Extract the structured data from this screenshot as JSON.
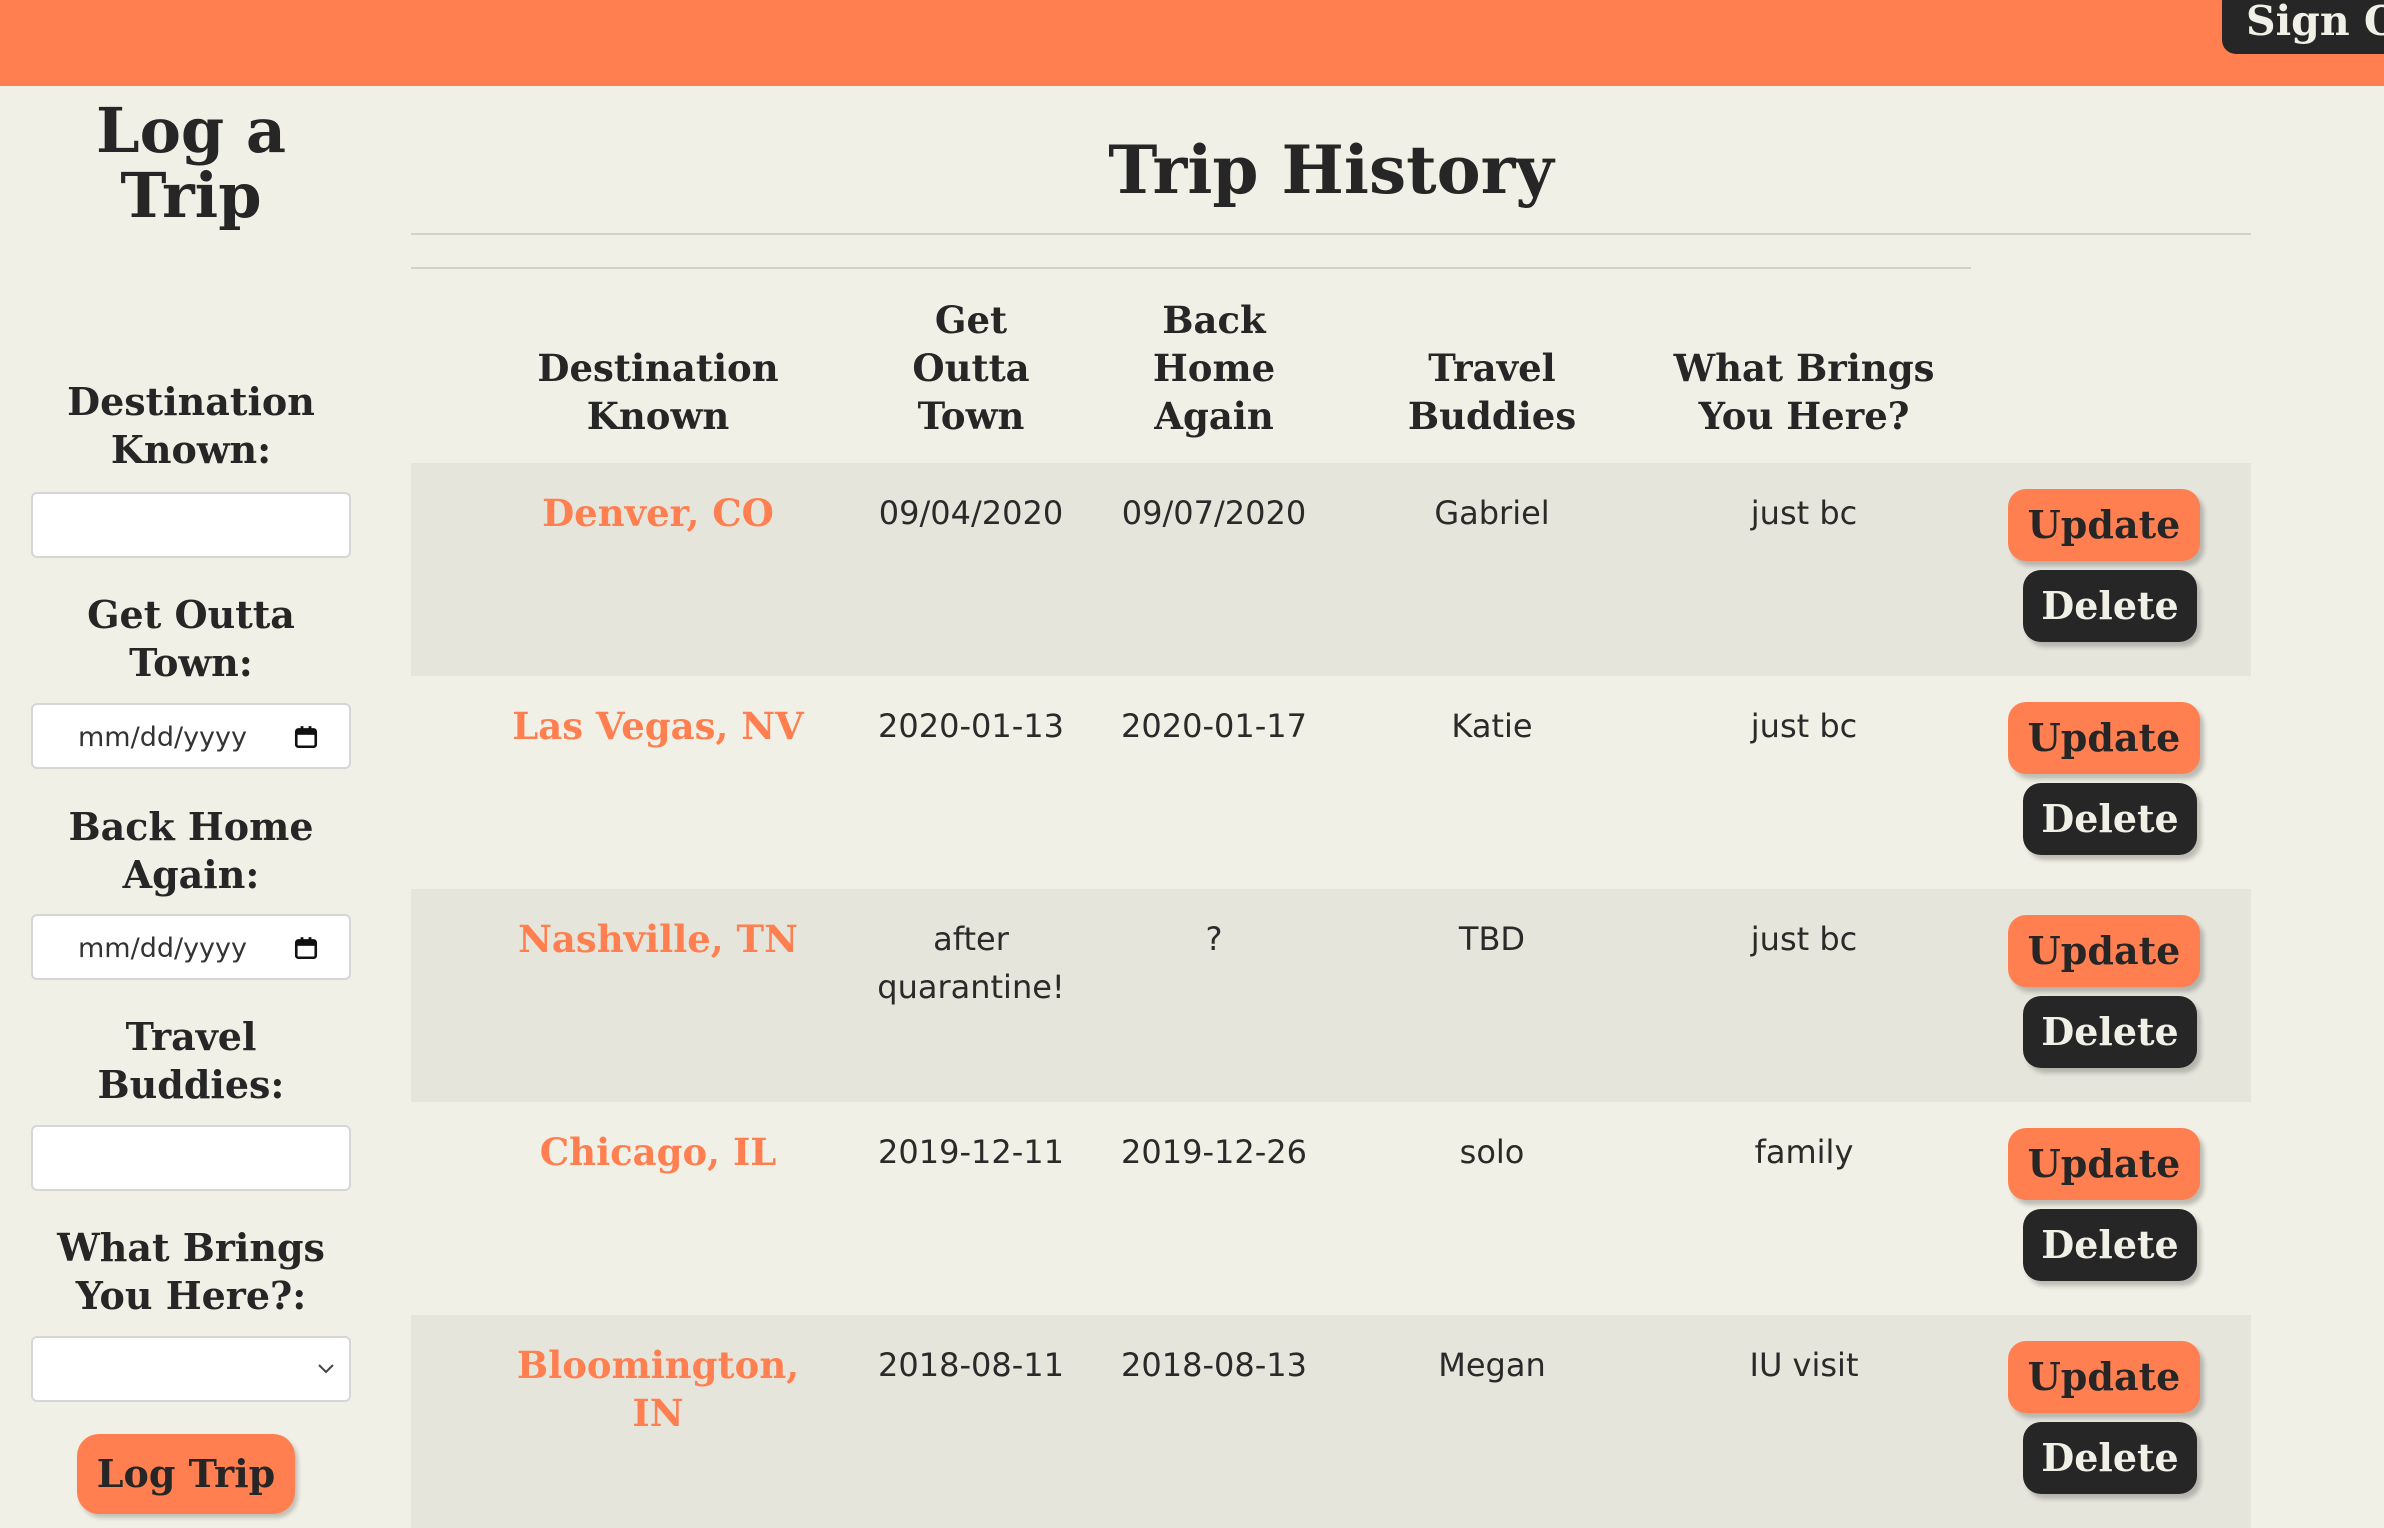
{
  "header": {
    "signout_label": "Sign Out"
  },
  "form": {
    "title_line1": "Log a",
    "title_line2": "Trip",
    "destination_label_line1": "Destination",
    "destination_label_line2": "Known:",
    "depart_label_line1": "Get Outta",
    "depart_label_line2": "Town:",
    "depart_placeholder": "mm/dd/yyyy",
    "return_label_line1": "Back Home",
    "return_label_line2": "Again:",
    "return_placeholder": "mm/dd/yyyy",
    "buddies_label_line1": "Travel",
    "buddies_label_line2": "Buddies:",
    "reason_label_line1": "What Brings",
    "reason_label_line2": "You Here?:",
    "submit_label": "Log Trip"
  },
  "history": {
    "title": "Trip History",
    "columns": [
      [
        "Destination",
        "Known"
      ],
      [
        "Get",
        "Outta",
        "Town"
      ],
      [
        "Back",
        "Home",
        "Again"
      ],
      [
        "Travel",
        "Buddies"
      ],
      [
        "What Brings",
        "You Here?"
      ]
    ],
    "update_label": "Update",
    "delete_label": "Delete",
    "rows": [
      {
        "destination": [
          "Denver, CO"
        ],
        "depart": [
          "09/04/2020"
        ],
        "return": [
          "09/07/2020"
        ],
        "buddies": "Gabriel",
        "reason": "just bc"
      },
      {
        "destination": [
          "Las Vegas, NV"
        ],
        "depart": [
          "2020-01-13"
        ],
        "return": [
          "2020-01-17"
        ],
        "buddies": "Katie",
        "reason": "just bc"
      },
      {
        "destination": [
          "Nashville, TN"
        ],
        "depart": [
          "after",
          "quarantine!"
        ],
        "return": [
          "?"
        ],
        "buddies": "TBD",
        "reason": "just bc"
      },
      {
        "destination": [
          "Chicago, IL"
        ],
        "depart": [
          "2019-12-11"
        ],
        "return": [
          "2019-12-26"
        ],
        "buddies": "solo",
        "reason": "family"
      },
      {
        "destination": [
          "Bloomington,",
          "IN"
        ],
        "depart": [
          "2018-08-11"
        ],
        "return": [
          "2018-08-13"
        ],
        "buddies": "Megan",
        "reason": "IU visit"
      }
    ]
  },
  "colors": {
    "accent": "#ff7f50",
    "dark": "#262626",
    "background": "#f1f0e6",
    "row_shade": "#e6e5dc"
  }
}
